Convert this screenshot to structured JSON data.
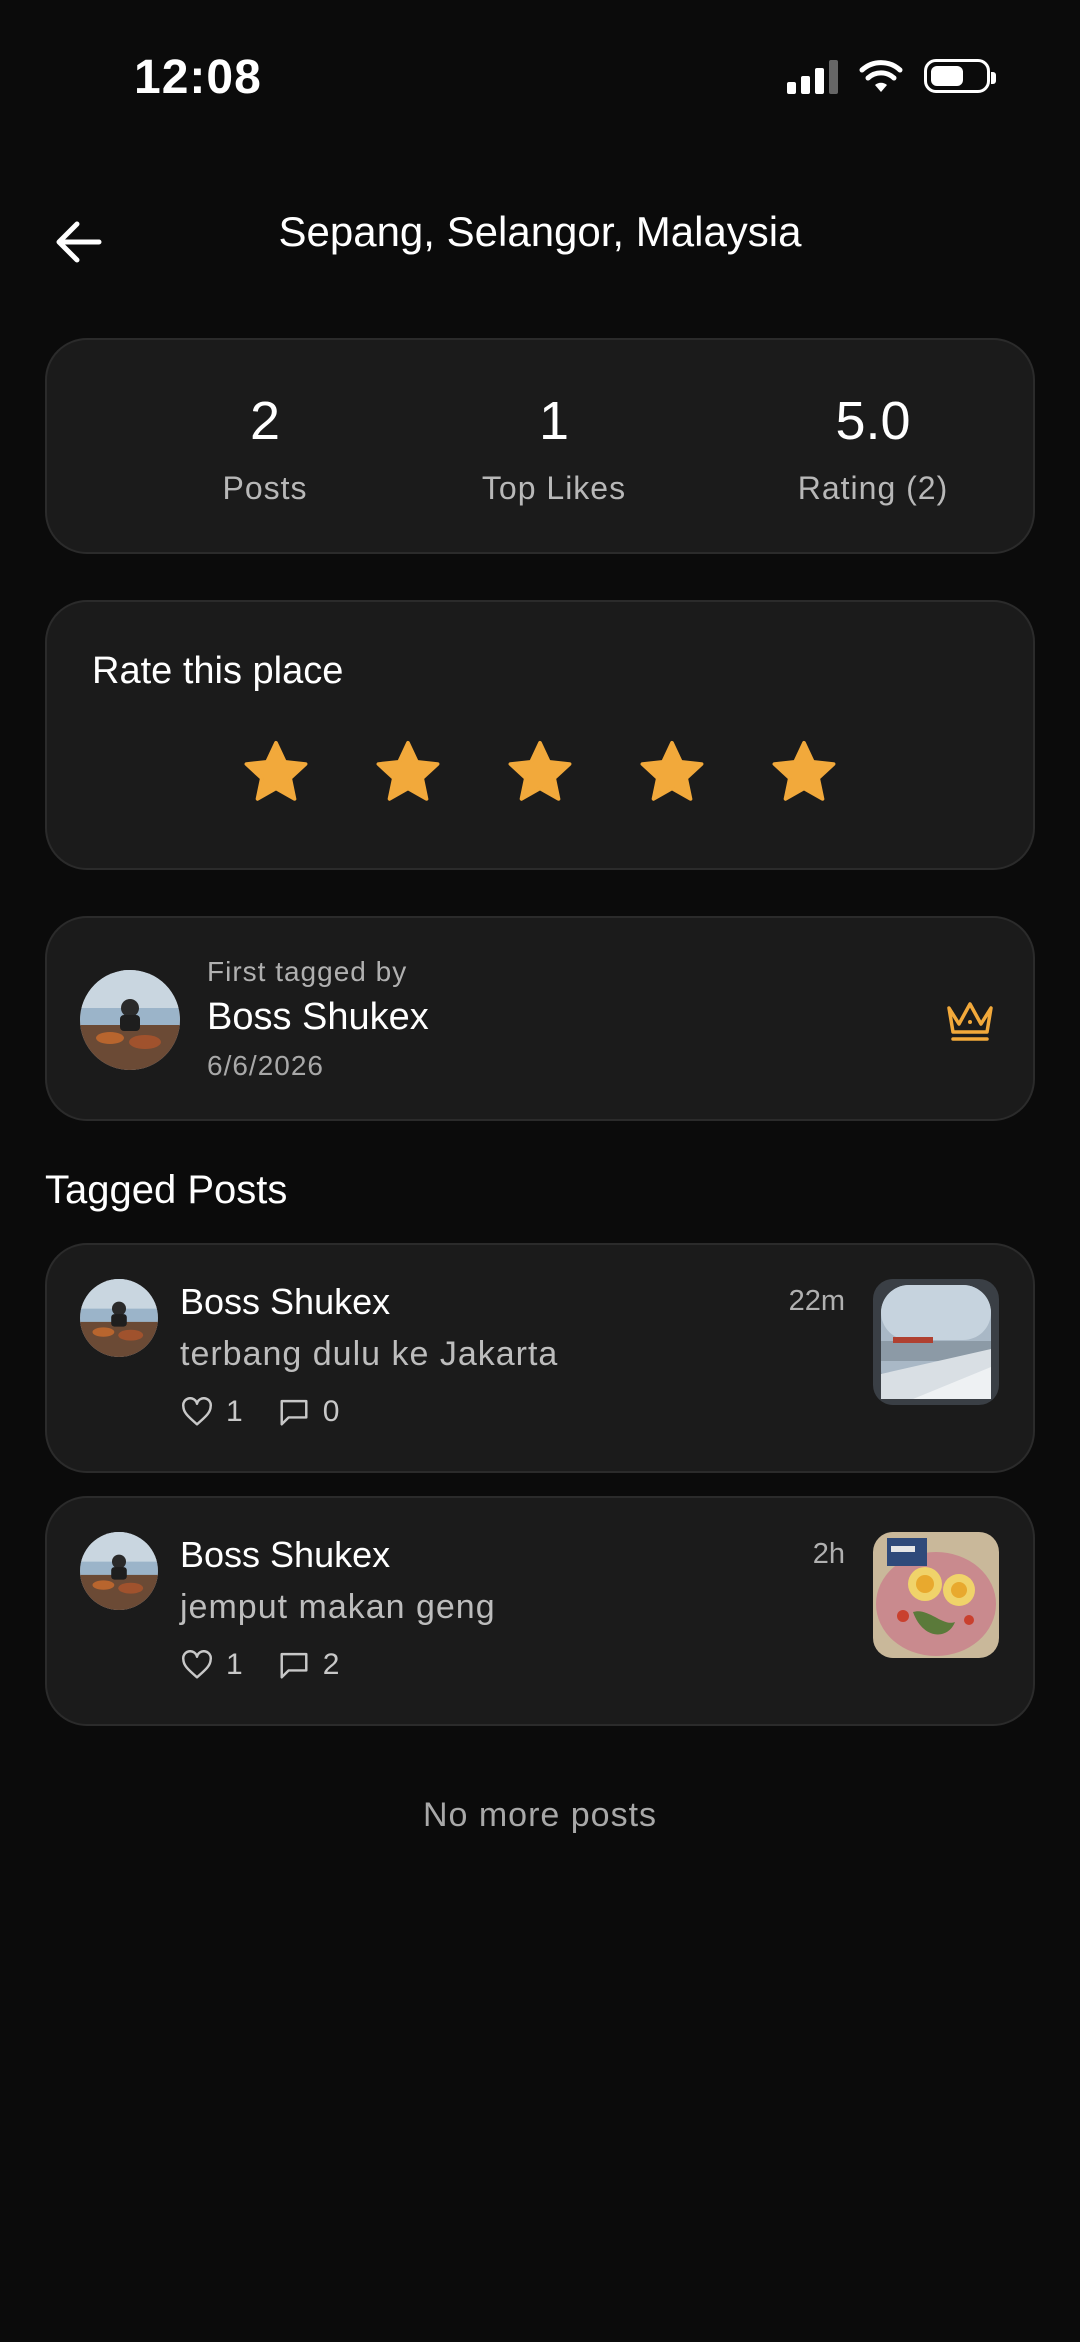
{
  "status_bar": {
    "time": "12:08"
  },
  "header": {
    "title": "Sepang, Selangor, Malaysia"
  },
  "stats": [
    {
      "value": "2",
      "label": "Posts"
    },
    {
      "value": "1",
      "label": "Top Likes"
    },
    {
      "value": "5.0",
      "label": "Rating (2)"
    }
  ],
  "rating": {
    "heading": "Rate this place",
    "selected_stars": 5,
    "max_stars": 5,
    "star_color": "#f2a93b"
  },
  "first_tagged": {
    "caption": "First tagged by",
    "name": "Boss Shukex",
    "date": "6/6/2026"
  },
  "tagged_posts": {
    "heading": "Tagged Posts",
    "items": [
      {
        "name": "Boss Shukex",
        "time": "22m",
        "text": "terbang dulu ke Jakarta",
        "likes": "1",
        "comments": "0"
      },
      {
        "name": "Boss Shukex",
        "time": "2h",
        "text": "jemput makan geng",
        "likes": "1",
        "comments": "2"
      }
    ],
    "footer": "No more posts"
  },
  "colors": {
    "background": "#0b0b0b",
    "card": "#1b1b1b",
    "accent": "#f2a93b"
  }
}
